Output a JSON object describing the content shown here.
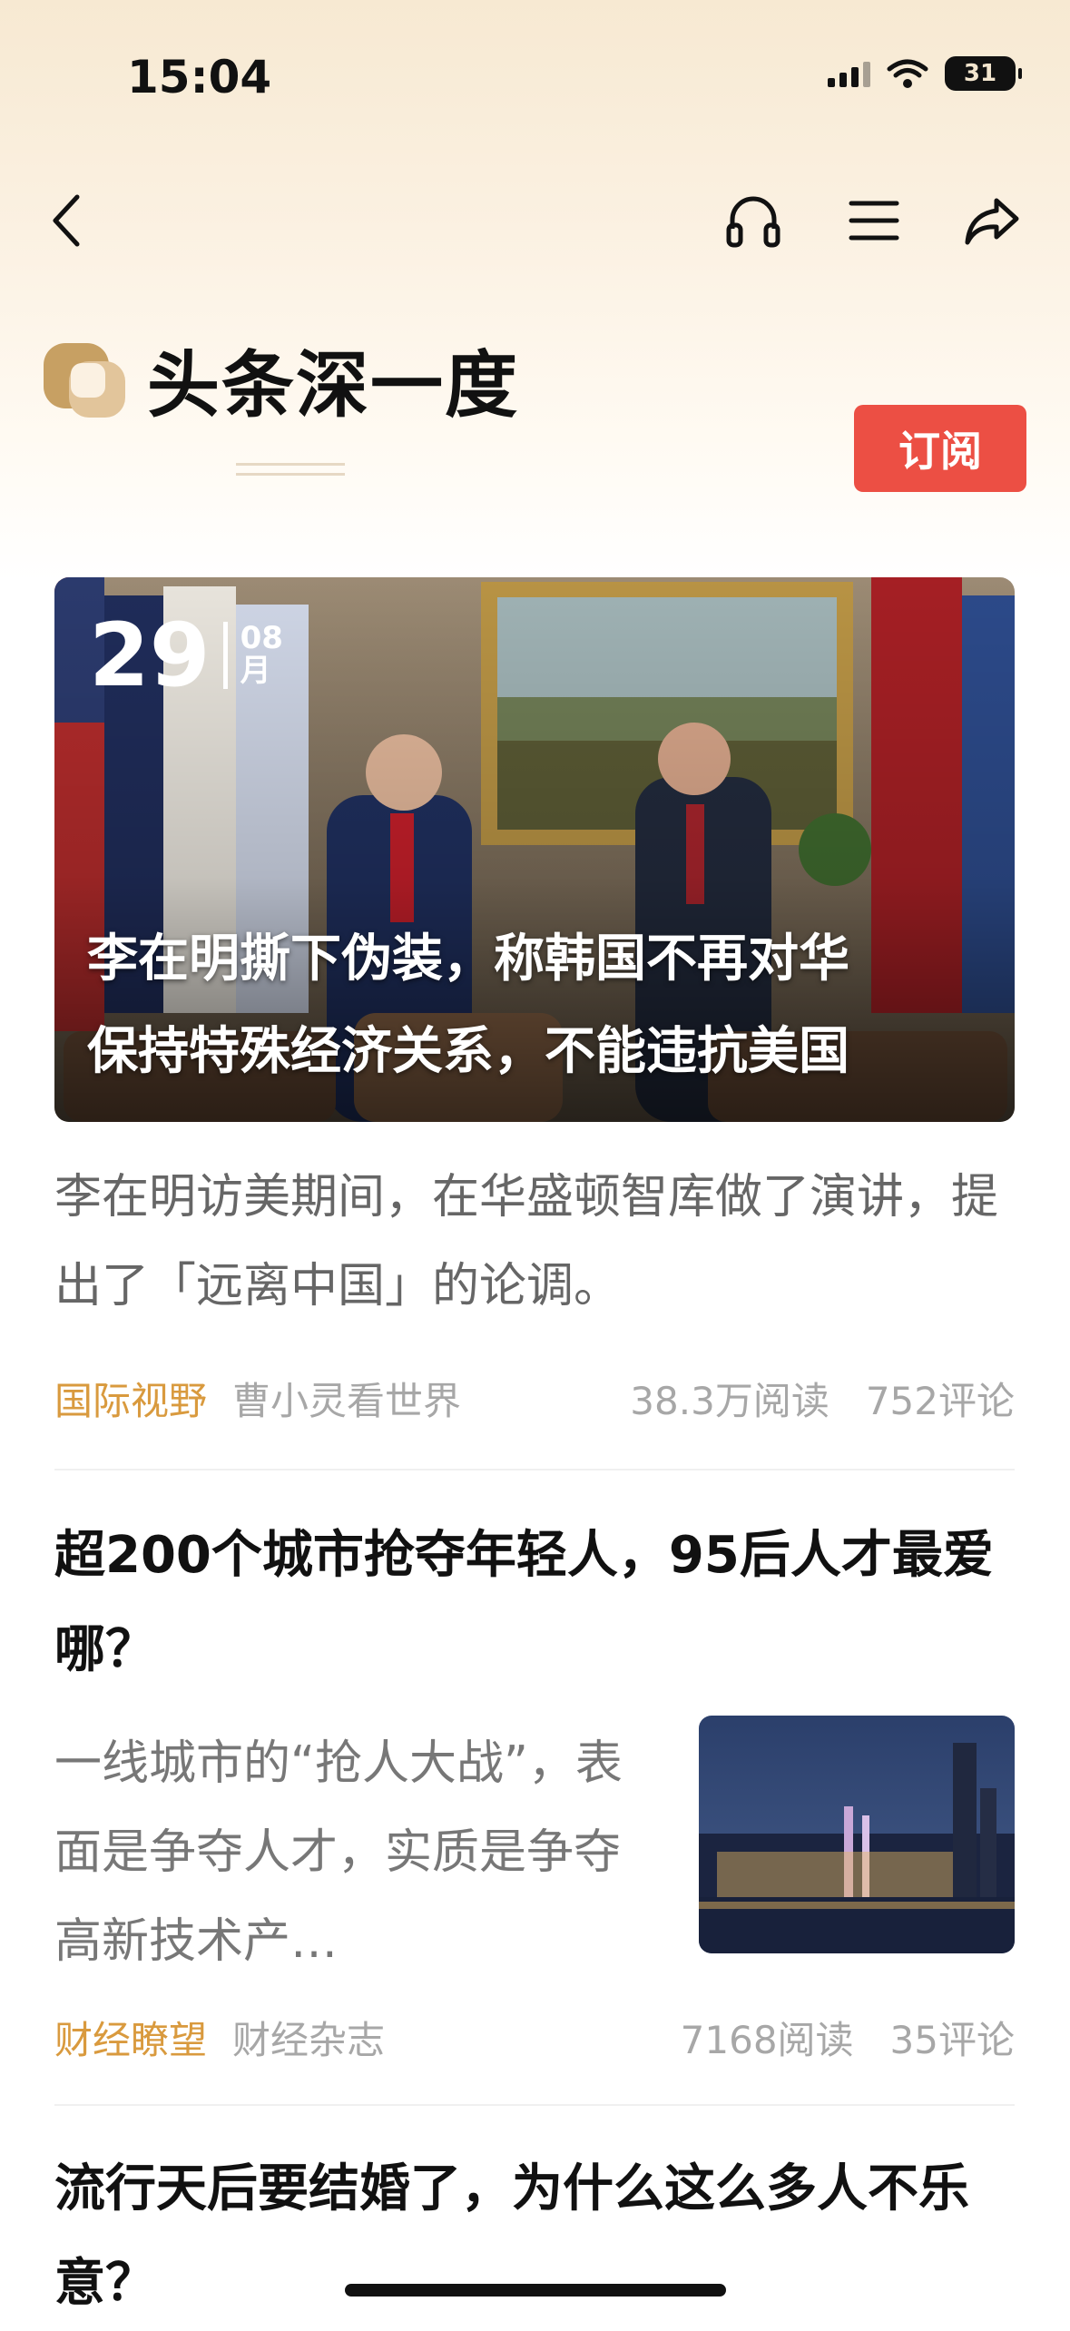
{
  "status_bar": {
    "time": "15:04",
    "battery": "31"
  },
  "nav": {
    "icons": [
      "back-icon",
      "headphones-icon",
      "menu-icon",
      "share-icon"
    ]
  },
  "brand": {
    "title": "头条深一度",
    "subscribe_label": "订阅"
  },
  "colors": {
    "subscribe": "#ec4f44",
    "category": "#d99a3e"
  },
  "articles": [
    {
      "date_day": "29",
      "date_month": "08",
      "date_month_unit": "月",
      "title_line1": "李在明撕下伪装，称韩国不再对华",
      "title_line2": "保持特殊经济关系，不能违抗美国",
      "summary": "李在明访美期间，在华盛顿智库做了演讲，提出了「远离中国」的论调。",
      "category": "国际视野",
      "author": "曹小灵看世界",
      "reads": "38.3万阅读",
      "comments": "752评论"
    },
    {
      "title": "超200个城市抢夺年轻人，95后人才最爱哪？",
      "summary": "一线城市的“抢人大战”，表面是争夺人才，实质是争夺高新技术产…",
      "category": "财经瞭望",
      "author": "财经杂志",
      "reads": "7168阅读",
      "comments": "35评论"
    },
    {
      "title": "流行天后要结婚了，为什么这么多人不乐意？"
    }
  ]
}
